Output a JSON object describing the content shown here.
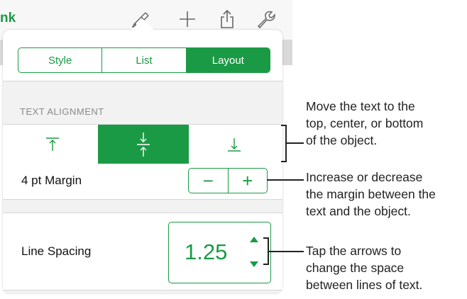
{
  "toolbar": {
    "back_label": "nk",
    "icons": [
      "paintbrush-icon",
      "plus-icon",
      "share-icon",
      "wrench-icon"
    ]
  },
  "tabs": [
    {
      "label": "Style",
      "selected": false
    },
    {
      "label": "List",
      "selected": false
    },
    {
      "label": "Layout",
      "selected": true
    }
  ],
  "text_alignment": {
    "section_title": "TEXT ALIGNMENT",
    "options": [
      "align-top-icon",
      "align-middle-icon",
      "align-bottom-icon"
    ],
    "selected": "middle"
  },
  "margin": {
    "label": "4 pt Margin",
    "decrease": "−",
    "increase": "+"
  },
  "line_spacing": {
    "label": "Line Spacing",
    "value": "1.25"
  },
  "callouts": {
    "alignment": [
      "Move the text to the",
      "top, center, or bottom",
      "of the object."
    ],
    "margin": [
      "Increase or decrease",
      "the margin between the",
      "text and the object."
    ],
    "spacing": [
      "Tap the arrows to",
      "change the space",
      "between lines of text."
    ]
  },
  "colors": {
    "accent": "#1b9a45",
    "panel_bg": "#f2f2f2"
  }
}
